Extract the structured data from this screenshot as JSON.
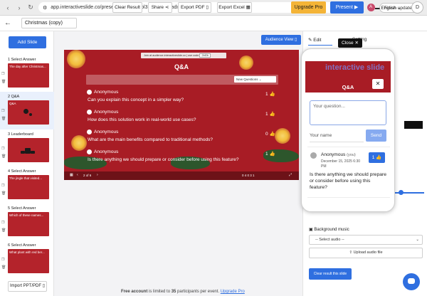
{
  "browser": {
    "url": "app.interactiveslide.co/presentation/2z83ol33fevr1tu69adx",
    "profile_initial": "A",
    "finish_update": "Finish update"
  },
  "header": {
    "presentation_title": "Christmas (copy)",
    "clear_result": "Clear Result",
    "share": "Share",
    "export_pdf": "Export PDF",
    "export_excel": "Export Excel",
    "upgrade": "Upgrade Pro",
    "present": "Present",
    "language": "English",
    "user_initial": "D"
  },
  "sidebar": {
    "add_slide": "Add Slide",
    "slides": [
      {
        "label": "1 Select Answer",
        "thumb_text": "The day after Christmas..."
      },
      {
        "label": "2 Q&A",
        "thumb_text": "Q&A"
      },
      {
        "label": "3 Leaderboard",
        "thumb_text": ""
      },
      {
        "label": "4 Select Answer",
        "thumb_text": "The jingle that visited..."
      },
      {
        "label": "5 Select Answer",
        "thumb_text": "Which of these names..."
      },
      {
        "label": "6 Select Answer",
        "thumb_text": "What plant with red ber..."
      }
    ],
    "import": "Import PPT/PDF"
  },
  "stage": {
    "audience_view": "Audience View",
    "slide": {
      "join_text": "Join at audience.interactiveslide.co | use code",
      "join_code": "2bf2b",
      "title": "Q&A",
      "filter": "New Questions",
      "questions": [
        {
          "name": "Anonymous",
          "text": "Can you explain this concept in a simpler way?",
          "votes": "1"
        },
        {
          "name": "Anonymous",
          "text": "How does this solution work in real-world use cases?",
          "votes": "1"
        },
        {
          "name": "Anonymous",
          "text": "What are the main benefits compared to traditional methods?",
          "votes": "0"
        },
        {
          "name": "Anonymous",
          "text": "Is there anything we should prepare or consider before using this feature?",
          "votes": "1"
        }
      ],
      "page_indicator": "2 of 6",
      "stats": "0  4  0  3  1"
    },
    "footer": {
      "prefix": "Free account",
      "middle": " is limited to ",
      "count": "35",
      "suffix": " participants per event. ",
      "link": "Upgrade Pro"
    }
  },
  "right_panel": {
    "tab_edit": "Edit",
    "tab_setting": "Setting",
    "close_chip": "Close",
    "bg_music_label": "Background music",
    "select_audio": "-- Select audio --",
    "upload_audio": "Upload audio file",
    "clear_slide": "Clear result this slide"
  },
  "phone": {
    "logo": "interactive slide",
    "banner_title": "Q&A",
    "question_placeholder": "Your question...",
    "name_placeholder": "Your name",
    "send": "Send",
    "post": {
      "name": "Anonymous",
      "tag": "(you)",
      "time": "December 15, 2025 6:30 PM",
      "votes": "1",
      "text": "Is there anything we should prepare or consider before using this feature?"
    }
  }
}
